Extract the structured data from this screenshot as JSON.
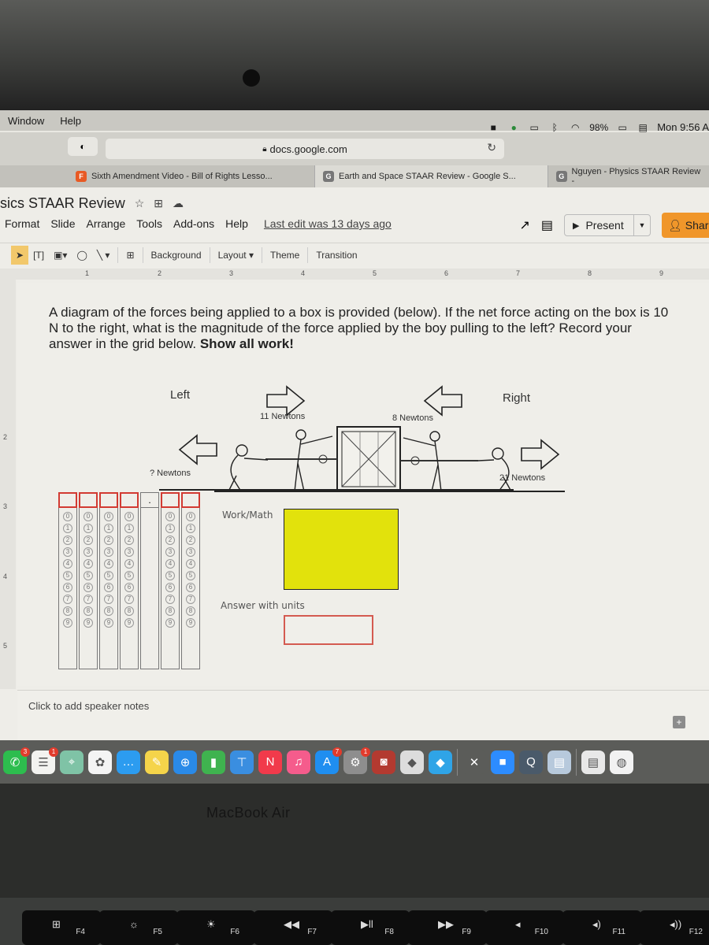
{
  "menubar": {
    "items": [
      "Window",
      "Help"
    ],
    "status": {
      "battery": "98%",
      "clock": "Mon 9:56 A"
    },
    "status_icons": [
      "facetime-icon",
      "green-app-icon",
      "airplay-icon",
      "bluetooth-icon",
      "wifi-icon",
      "battery-icon",
      "flag-icon"
    ]
  },
  "browser": {
    "url": "docs.google.com",
    "tabs": [
      {
        "label": "Sixth Amendment Video - Bill of Rights Lesso...",
        "favicon": "F",
        "active": false
      },
      {
        "label": "Earth and Space STAAR Review - Google S...",
        "favicon": "G",
        "active": true
      },
      {
        "label": "Nguyen - Physics STAAR Review - ",
        "favicon": "G",
        "active": false
      }
    ]
  },
  "slides": {
    "title": "sics STAAR Review",
    "menus": [
      "Format",
      "Slide",
      "Arrange",
      "Tools",
      "Add-ons",
      "Help"
    ],
    "last_edit": "Last edit was 13 days ago",
    "present_label": "Present",
    "share_label": "Share",
    "toolbar": {
      "background": "Background",
      "layout": "Layout",
      "theme": "Theme",
      "transition": "Transition"
    },
    "ruler_h": [
      "1",
      "2",
      "3",
      "4",
      "5",
      "6",
      "7",
      "8",
      "9"
    ],
    "ruler_v": [
      "2",
      "3",
      "4",
      "5"
    ]
  },
  "slide": {
    "question": "A diagram of the forces being applied to a box is provided (below).  If the net force acting on the box is 10 N to the right, what is the magnitude of the force applied by the boy pulling to the left?  Record your answer in the grid below.",
    "question_bold": "Show all work!",
    "left_label": "Left",
    "right_label": "Right",
    "forces": {
      "left_boy": "? Newtons",
      "left_girl": "11 Newtons",
      "right_girl": "8 Newtons",
      "right_boy": "21 Newtons"
    },
    "grid": {
      "decimal": ".",
      "digits": [
        "0",
        "1",
        "2",
        "3",
        "4",
        "5",
        "6",
        "7",
        "8",
        "9"
      ]
    },
    "work_label": "Work/Math",
    "answer_label": "Answer with units"
  },
  "notes": {
    "placeholder": "Click to add speaker notes"
  },
  "dock": {
    "apps": [
      {
        "name": "facetime",
        "glyph": "✆",
        "color": "#2dbd4e",
        "badge": "3"
      },
      {
        "name": "reminders",
        "glyph": "☰",
        "color": "#f3f3f0",
        "badge": "1"
      },
      {
        "name": "maps",
        "glyph": "⌖",
        "color": "#7fc3a6"
      },
      {
        "name": "photos",
        "glyph": "✿",
        "color": "#f4f4f4"
      },
      {
        "name": "messages",
        "glyph": "…",
        "color": "#2c9cf0"
      },
      {
        "name": "notes",
        "glyph": "✎",
        "color": "#f5d44a"
      },
      {
        "name": "safari",
        "glyph": "⊕",
        "color": "#2a8ae8"
      },
      {
        "name": "numbers",
        "glyph": "▮",
        "color": "#3fb34f"
      },
      {
        "name": "keynote",
        "glyph": "⊤",
        "color": "#3a8ee0"
      },
      {
        "name": "news",
        "glyph": "N",
        "color": "#f13a4b"
      },
      {
        "name": "music",
        "glyph": "♫",
        "color": "#f55c8c"
      },
      {
        "name": "app-store",
        "glyph": "A",
        "color": "#1f8ef0",
        "badge": "7"
      },
      {
        "name": "system-preferences",
        "glyph": "⚙",
        "color": "#8e8e8e",
        "badge": "1"
      },
      {
        "name": "photo-booth",
        "glyph": "◙",
        "color": "#b33a30"
      },
      {
        "name": "roblox-studio",
        "glyph": "◆",
        "color": "#dcdcdc"
      },
      {
        "name": "roblox",
        "glyph": "◆",
        "color": "#2fa4e7"
      }
    ],
    "apps_right": [
      {
        "name": "utilities",
        "glyph": "✕",
        "color": "#5b5c59"
      },
      {
        "name": "zoom",
        "glyph": "■",
        "color": "#2d8cff"
      },
      {
        "name": "quicktime",
        "glyph": "Q",
        "color": "#4a5a6a"
      },
      {
        "name": "preview",
        "glyph": "▤",
        "color": "#b7c9dc"
      }
    ],
    "docs": [
      {
        "name": "document-1",
        "glyph": "▤",
        "color": "#e8e8e8"
      },
      {
        "name": "document-2",
        "glyph": "◍",
        "color": "#f2f2f2"
      }
    ]
  },
  "hardware": {
    "brand": "MacBook Air",
    "keys": [
      {
        "glyph": "⊞",
        "label": "F4"
      },
      {
        "glyph": "☼",
        "label": "F5"
      },
      {
        "glyph": "☀",
        "label": "F6"
      },
      {
        "glyph": "◀◀",
        "label": "F7"
      },
      {
        "glyph": "▶ll",
        "label": "F8"
      },
      {
        "glyph": "▶▶",
        "label": "F9"
      },
      {
        "glyph": "◂",
        "label": "F10"
      },
      {
        "glyph": "◂)",
        "label": "F11"
      },
      {
        "glyph": "◂))",
        "label": "F12"
      }
    ]
  }
}
